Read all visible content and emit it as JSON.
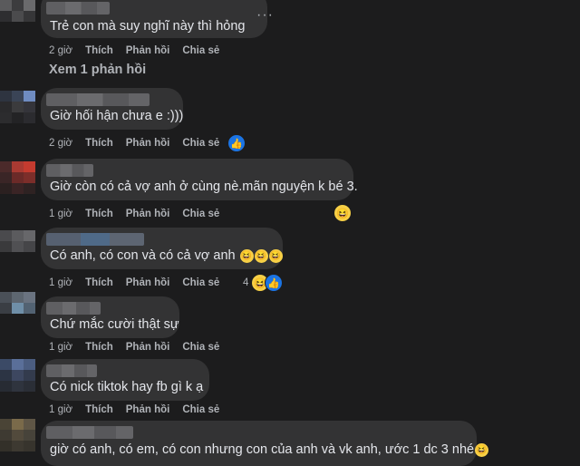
{
  "comments": [
    {
      "text": "Trẻ con mà suy nghĩ này thì hỏng",
      "time": "2 giờ",
      "more": "···",
      "view_replies": "Xem 1 phản hồi"
    },
    {
      "text": "Giờ hối hận chưa e :)))",
      "time": "2 giờ"
    },
    {
      "text": "Giờ còn có cả vợ anh ở cùng nè.mãn nguyện k bé 3.",
      "time": "1 giờ"
    },
    {
      "text": "Có anh, có con và có cả vợ anh",
      "time": "1 giờ",
      "reaction_count": "4"
    },
    {
      "text": "Chứ mắc cười thật sự",
      "time": "1 giờ"
    },
    {
      "text": "Có nick tiktok hay fb gì k ạ",
      "time": "1 giờ"
    },
    {
      "text": "giờ có anh, có em, có con nhưng con của anh và vk anh, ước 1 dc 3 nhé",
      "time": ""
    }
  ],
  "actions": {
    "like": "Thích",
    "reply": "Phản hồi",
    "share": "Chia sẻ"
  },
  "icons": {
    "laugh": "laugh-emoji-icon",
    "like": "like-thumb-icon",
    "more": "more-dots-icon"
  },
  "colors": {
    "background": "#1c1c1d",
    "bubble": "#333334",
    "text": "#e4e6eb",
    "muted": "#b0b3b8",
    "like_blue": "#1b74e4",
    "laugh_yellow": "#f7d046"
  }
}
